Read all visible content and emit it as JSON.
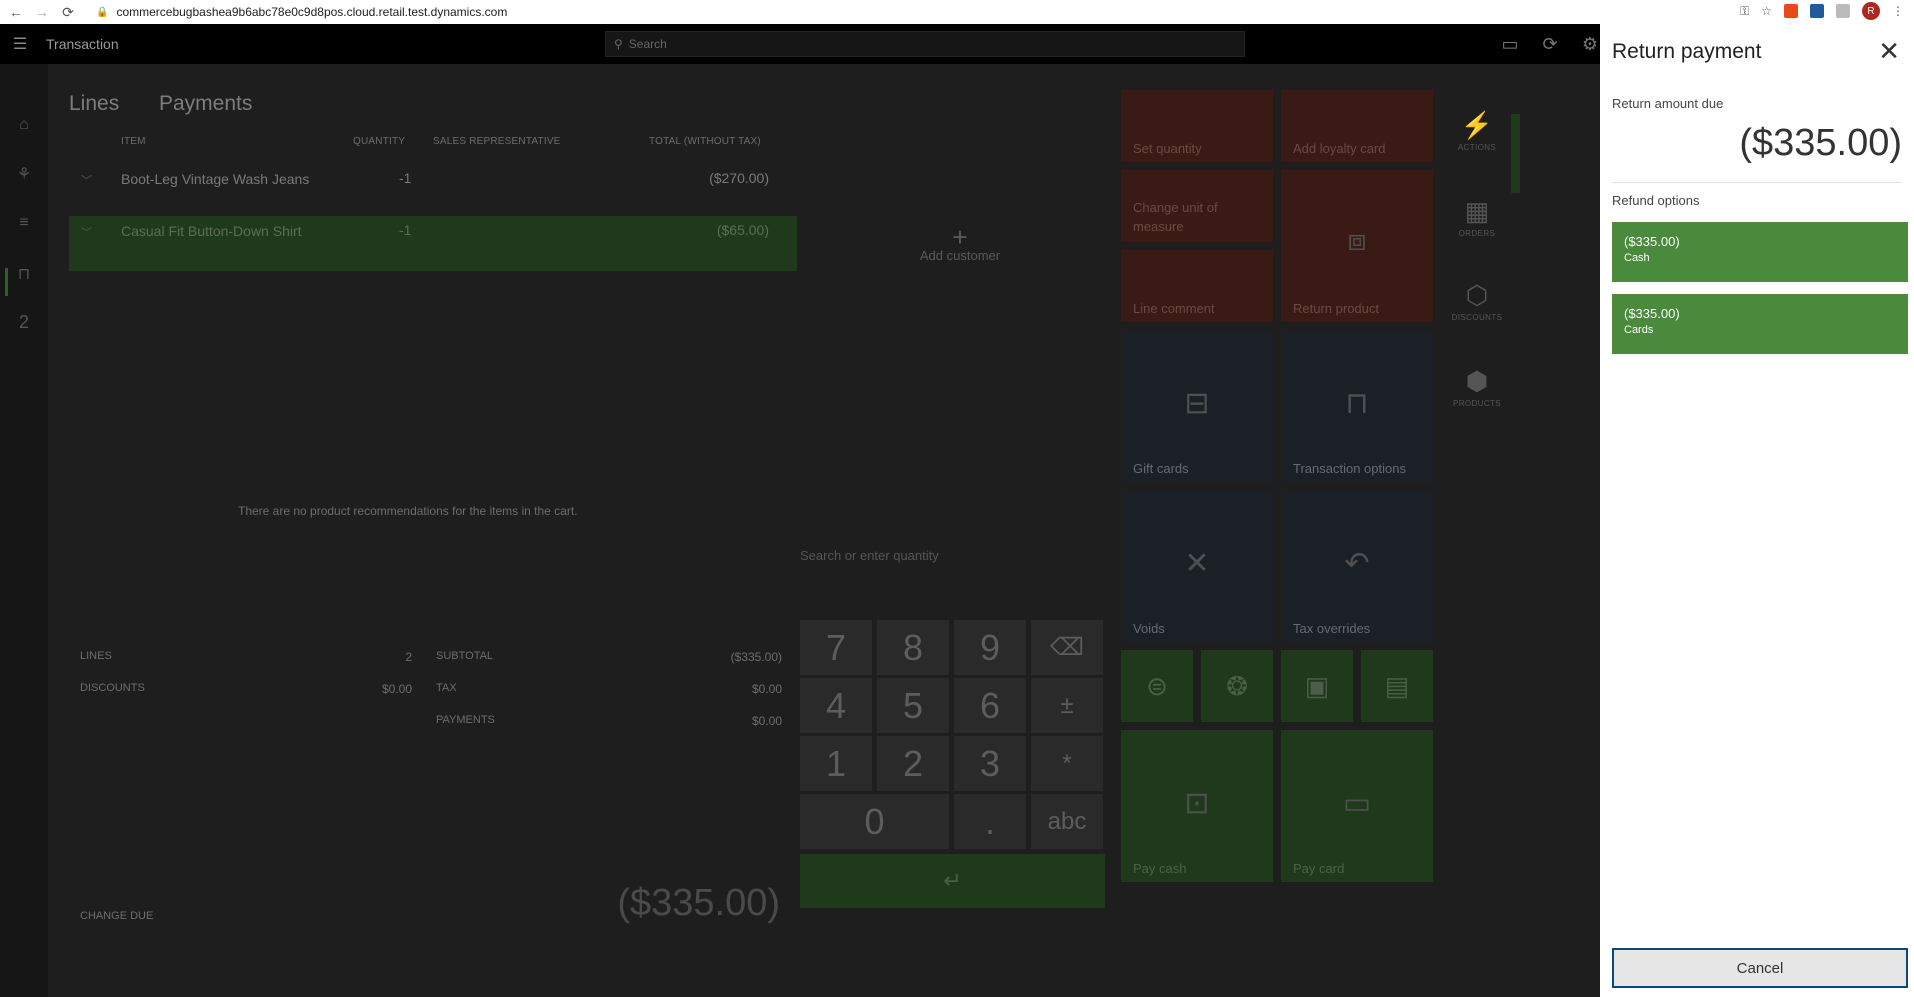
{
  "browser": {
    "url": "commercebugbashea9b6abc78e0c9d8pos.cloud.retail.test.dynamics.com",
    "avatar_initial": "R"
  },
  "app": {
    "title": "Transaction",
    "search_placeholder": "Search",
    "rail_count": "2"
  },
  "tabs": {
    "lines": "Lines",
    "payments": "Payments"
  },
  "columns": {
    "item": "ITEM",
    "quantity": "QUANTITY",
    "sales_rep": "SALES REPRESENTATIVE",
    "total": "TOTAL (WITHOUT TAX)"
  },
  "lines": [
    {
      "name": "Boot-Leg Vintage Wash Jeans",
      "qty": "-1",
      "total": "($270.00)"
    },
    {
      "name": "Casual Fit Button-Down Shirt",
      "qty": "-1",
      "total": "($65.00)"
    }
  ],
  "add_customer": "Add customer",
  "no_recommendations": "There are no product recommendations for the items in the cart.",
  "qty_placeholder": "Search or enter quantity",
  "summary": {
    "lines_label": "LINES",
    "lines_value": "2",
    "discounts_label": "DISCOUNTS",
    "discounts_value": "$0.00",
    "subtotal_label": "SUBTOTAL",
    "subtotal_value": "($335.00)",
    "tax_label": "TAX",
    "tax_value": "$0.00",
    "payments_label": "PAYMENTS",
    "payments_value": "$0.00",
    "change_due_label": "CHANGE DUE",
    "change_due_value": "($335.00)"
  },
  "numpad": {
    "k7": "7",
    "k8": "8",
    "k9": "9",
    "kback": "⌫",
    "k4": "4",
    "k5": "5",
    "k6": "6",
    "kpm": "±",
    "k1": "1",
    "k2": "2",
    "k3": "3",
    "kstar": "*",
    "k0": "0",
    "kdot": ".",
    "kabc": "abc",
    "enter": "↵"
  },
  "tiles": {
    "set_quantity": "Set quantity",
    "add_loyalty_card": "Add loyalty card",
    "change_unit": "Change unit of measure",
    "return_product": "Return product",
    "line_comment": "Line comment",
    "gift_cards": "Gift cards",
    "transaction_options": "Transaction options",
    "voids": "Voids",
    "tax_overrides": "Tax overrides",
    "pay_cash": "Pay cash",
    "pay_card": "Pay card"
  },
  "side_buttons": {
    "actions": "ACTIONS",
    "orders": "ORDERS",
    "discounts": "DISCOUNTS",
    "products": "PRODUCTS"
  },
  "panel": {
    "title": "Return payment",
    "due_label": "Return amount due",
    "due_amount": "($335.00)",
    "refund_label": "Refund options",
    "options": [
      {
        "amount": "($335.00)",
        "method": "Cash"
      },
      {
        "amount": "($335.00)",
        "method": "Cards"
      }
    ],
    "cancel": "Cancel"
  }
}
